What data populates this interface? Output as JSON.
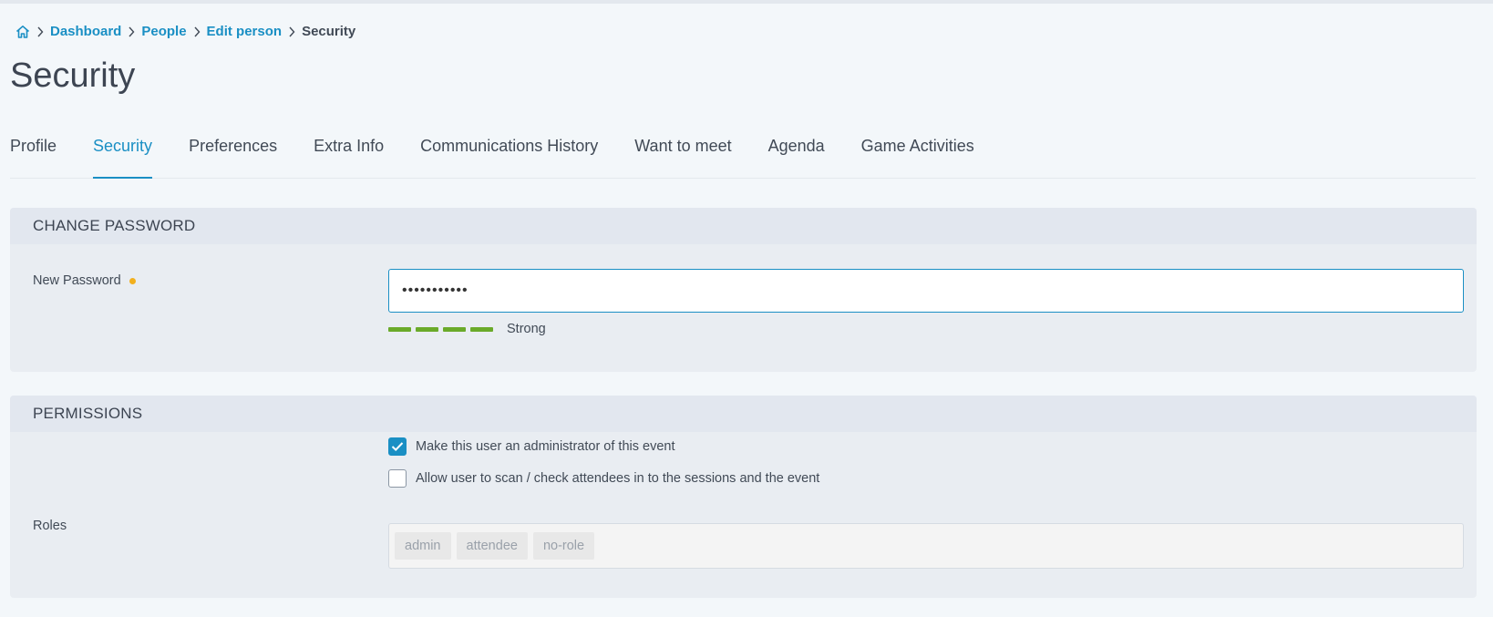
{
  "breadcrumb": {
    "home_icon": "home-icon",
    "items": [
      "Dashboard",
      "People",
      "Edit person"
    ],
    "current": "Security"
  },
  "page_title": "Security",
  "tabs": [
    {
      "label": "Profile",
      "active": false
    },
    {
      "label": "Security",
      "active": true
    },
    {
      "label": "Preferences",
      "active": false
    },
    {
      "label": "Extra Info",
      "active": false
    },
    {
      "label": "Communications History",
      "active": false
    },
    {
      "label": "Want to meet",
      "active": false
    },
    {
      "label": "Agenda",
      "active": false
    },
    {
      "label": "Game Activities",
      "active": false
    }
  ],
  "change_password": {
    "header": "CHANGE PASSWORD",
    "label": "New Password",
    "required": true,
    "value": "•••••••••••",
    "strength": {
      "segments_filled": 4,
      "segments_total": 4,
      "label": "Strong",
      "color": "#6aaa2a"
    }
  },
  "permissions": {
    "header": "PERMISSIONS",
    "admin_checkbox": {
      "label": "Make this user an administrator of this event",
      "checked": true
    },
    "scan_checkbox": {
      "label": "Allow user to scan / check attendees in to the sessions and the event",
      "checked": false
    },
    "roles_label": "Roles",
    "roles": [
      "admin",
      "attendee",
      "no-role"
    ]
  },
  "colors": {
    "accent": "#1a8fc4",
    "required_dot": "#f2b01e",
    "strength": "#6aaa2a"
  }
}
